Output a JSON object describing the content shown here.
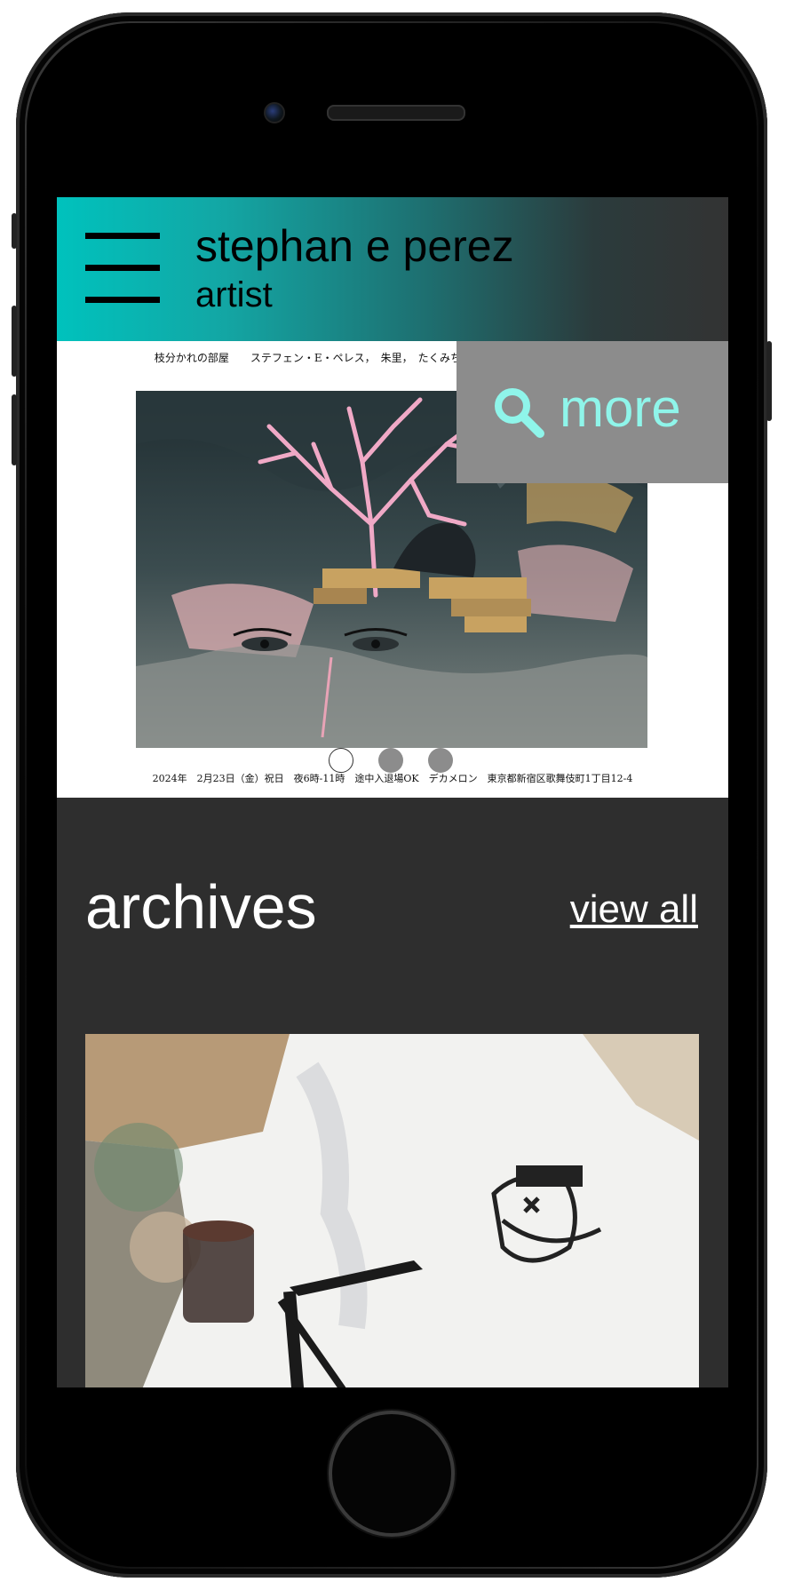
{
  "header": {
    "brand_name": "stephan e perez",
    "brand_role": "artist"
  },
  "hero": {
    "flyer_top_text": "枝分かれの部屋　　ステフェン・E・ペレス，　朱里，　たくみちゃん，　武谷 大介，　美秋 Meerkat",
    "flyer_bottom_text": "2024年　2月23日（金）祝日　夜6時-11時　途中入退場OK　デカメロン　東京都新宿区歌舞伎町1丁目12-4",
    "more_label": "more",
    "more_color": "#8ff5ea",
    "slides_total": 3,
    "active_slide": 1
  },
  "archives": {
    "title": "archives",
    "view_all_label": "view all"
  },
  "colors": {
    "header_gradient_start": "#00c2bd",
    "header_gradient_end": "#333333",
    "page_background": "#2e2e2e"
  }
}
